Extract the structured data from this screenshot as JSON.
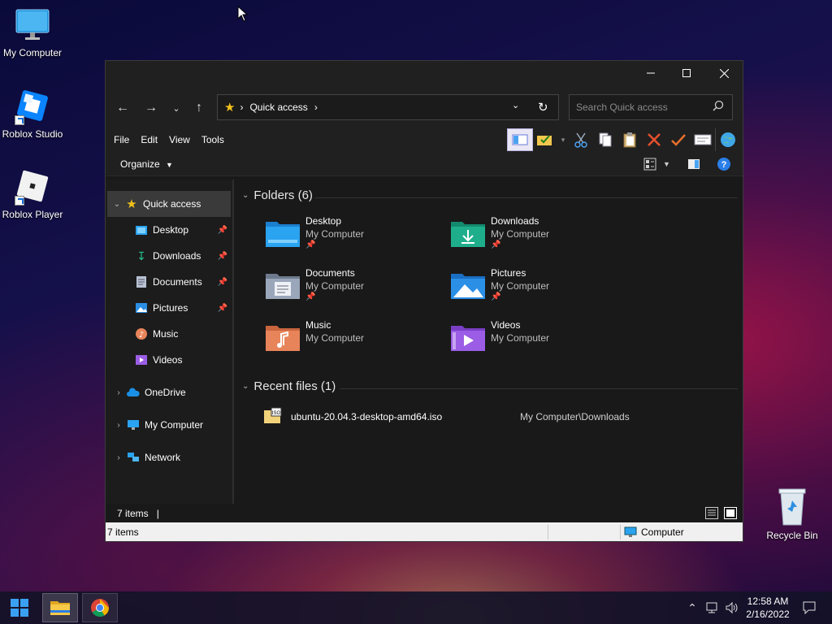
{
  "desktop": {
    "icons": [
      {
        "label": "My Computer"
      },
      {
        "label": "Roblox Studio"
      },
      {
        "label": "Roblox Player"
      },
      {
        "label": "Recycle Bin"
      }
    ]
  },
  "window": {
    "address": {
      "crumb": "Quick access"
    },
    "search_placeholder": "Search Quick access",
    "menu": [
      "File",
      "Edit",
      "View",
      "Tools"
    ],
    "organize_label": "Organize",
    "nav": {
      "quick_access": "Quick access",
      "pinned": [
        {
          "label": "Desktop"
        },
        {
          "label": "Downloads"
        },
        {
          "label": "Documents"
        },
        {
          "label": "Pictures"
        },
        {
          "label": "Music"
        },
        {
          "label": "Videos"
        }
      ],
      "onedrive": "OneDrive",
      "my_computer": "My Computer",
      "network": "Network"
    },
    "folders_header": "Folders (6)",
    "folders": [
      {
        "name": "Desktop",
        "location": "My Computer",
        "pinned": true,
        "color": "#2aa3f0"
      },
      {
        "name": "Downloads",
        "location": "My Computer",
        "pinned": true,
        "color": "#1fae8c"
      },
      {
        "name": "Documents",
        "location": "My Computer",
        "pinned": true,
        "color": "#8d9bb0"
      },
      {
        "name": "Pictures",
        "location": "My Computer",
        "pinned": true,
        "color": "#2b8fe6"
      },
      {
        "name": "Music",
        "location": "My Computer",
        "pinned": false,
        "color": "#e8845a"
      },
      {
        "name": "Videos",
        "location": "My Computer",
        "pinned": false,
        "color": "#9b5de5"
      }
    ],
    "recent_header": "Recent files (1)",
    "recent": [
      {
        "name": "ubuntu-20.04.3-desktop-amd64.iso",
        "path": "My Computer\\Downloads"
      }
    ],
    "status_items": "7 items",
    "bottom_items": "7 items",
    "bottom_location": "Computer"
  },
  "taskbar": {
    "time": "12:58 AM",
    "date": "2/16/2022"
  }
}
